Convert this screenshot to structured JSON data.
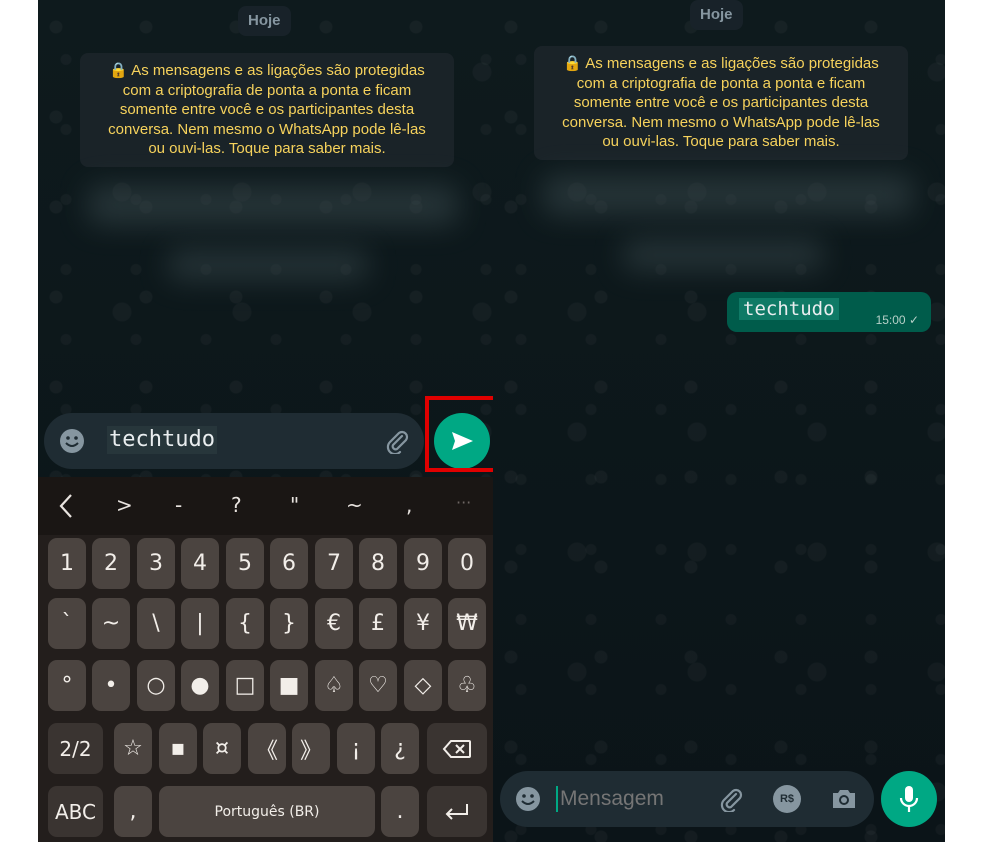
{
  "left_screen": {
    "date_chip": "Hoje",
    "encryption_notice": [
      "As mensagens e as ligações são protegidas",
      "com a criptografia de ponta a ponta e ficam",
      "somente entre você e os participantes desta",
      "conversa. Nem mesmo o WhatsApp pode lê-las",
      "ou ouvi-las. Toque para saber mais."
    ],
    "input_text": "techtudo",
    "keyboard": {
      "suggestion_row": [
        "<",
        ">",
        "-",
        "?",
        "\"",
        "~",
        ",",
        "···"
      ],
      "rows": [
        [
          "1",
          "2",
          "3",
          "4",
          "5",
          "6",
          "7",
          "8",
          "9",
          "0"
        ],
        [
          "`",
          "~",
          "\\",
          "|",
          "{",
          "}",
          "€",
          "£",
          "¥",
          "₩"
        ],
        [
          "°",
          "•",
          "○",
          "●",
          "□",
          "■",
          "♤",
          "♡",
          "◇",
          "♧"
        ]
      ],
      "row4": {
        "page": "2/2",
        "keys": [
          "☆",
          "▪",
          "¤",
          "《",
          "》",
          "¡",
          "¿"
        ],
        "backspace": "⌫"
      },
      "row5": {
        "abc": "ABC",
        "comma": ",",
        "space": "Português (BR)",
        "period": ".",
        "enter": "↵"
      }
    }
  },
  "right_screen": {
    "date_chip": "Hoje",
    "encryption_notice": [
      "As mensagens e as ligações são protegidas",
      "com a criptografia de ponta a ponta e ficam",
      "somente entre você e os participantes desta",
      "conversa. Nem mesmo o WhatsApp pode lê-las",
      "ou ouvi-las. Toque para saber mais."
    ],
    "sent_message": {
      "text": "techtudo",
      "time": "15:00",
      "status": "✓"
    },
    "input_placeholder": "Mensagem",
    "currency_icon_label": "R$"
  },
  "colors": {
    "accent": "#00a884",
    "highlight": "#e00000",
    "notice_text": "#f6d25c",
    "bubble": "#005c4b"
  }
}
